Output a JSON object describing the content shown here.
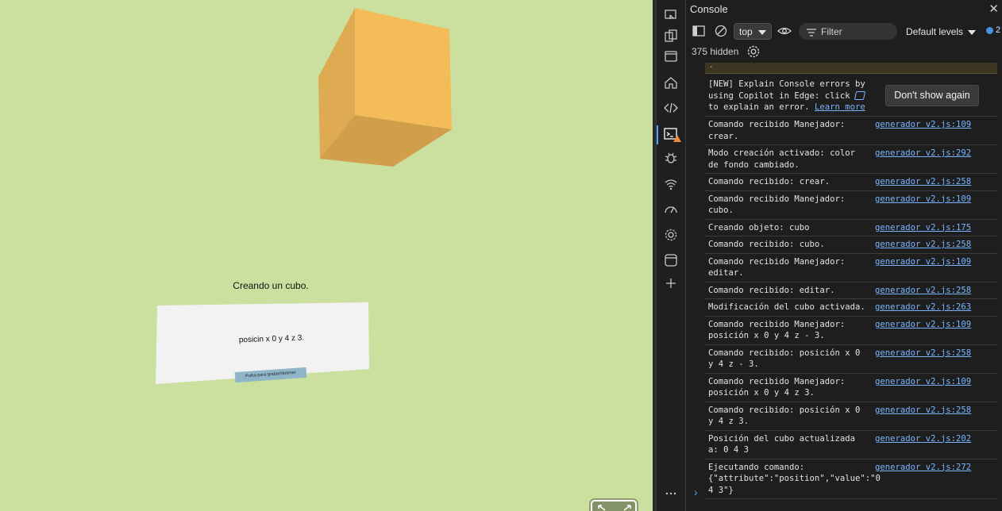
{
  "scene": {
    "background": "#cbe09f",
    "cube_colors": {
      "top": "#f3bc59",
      "left": "#deaa52",
      "bottom": "#d19e4c"
    },
    "caption": "Creando un cubo.",
    "panel_text": "posicin x 0 y 4 z 3.",
    "record_button": "Pulsa para grabar/detener",
    "vr_button_icon": "enter-vr-icon"
  },
  "devtools": {
    "activity_icons": [
      "device-emulation-icon",
      "inspect-icon",
      "browser-icon",
      "welcome-home-icon",
      "elements-code-icon",
      "console-icon",
      "sources-bug-icon",
      "network-wifi-icon",
      "performance-icon",
      "settings-gear-icon",
      "application-icon",
      "add-tool-icon",
      "more-tools-icon"
    ],
    "title": "Console",
    "context": "top",
    "filter_placeholder": "Filter",
    "levels": "Default levels",
    "issues_count": "2",
    "hidden_text": "375 hidden",
    "warning_fragment": ".",
    "copilot": {
      "line1": "[NEW] Explain Console errors by",
      "line2": "using Copilot in Edge: click",
      "line3": "to explain an error.",
      "learn_more": "Learn more",
      "dismiss": "Don't show again"
    },
    "messages": [
      {
        "text": "Comando recibido Manejador:\ncrear.",
        "source": "generador v2.js:109"
      },
      {
        "text": "Modo creación activado: color\nde fondo cambiado.",
        "source": "generador v2.js:292"
      },
      {
        "text": "Comando recibido: crear.",
        "source": "generador v2.js:258"
      },
      {
        "text": "Comando recibido Manejador:\ncubo.",
        "source": "generador v2.js:109"
      },
      {
        "text": "Creando objeto: cubo",
        "source": "generador v2.js:175"
      },
      {
        "text": "Comando recibido: cubo.",
        "source": "generador v2.js:258"
      },
      {
        "text": "Comando recibido Manejador:\neditar.",
        "source": "generador v2.js:109"
      },
      {
        "text": "Comando recibido: editar.",
        "source": "generador v2.js:258"
      },
      {
        "text": "Modificación del cubo activada.",
        "source": "generador v2.js:263"
      },
      {
        "text": "Comando recibido Manejador:\nposición x 0 y 4 z - 3.",
        "source": "generador v2.js:109"
      },
      {
        "text": "Comando recibido: posición x 0\ny 4 z - 3.",
        "source": "generador v2.js:258"
      },
      {
        "text": "Comando recibido Manejador:\nposición x 0 y 4 z 3.",
        "source": "generador v2.js:109"
      },
      {
        "text": "Comando recibido: posición x 0\ny 4 z 3.",
        "source": "generador v2.js:258"
      },
      {
        "text": "Posición del cubo actualizada\na: 0 4 3",
        "source": "generador v2.js:202"
      },
      {
        "text": "Ejecutando comando:\n{\"attribute\":\"position\",\"value\":\"0 4 3\"}",
        "source": "generador v2.js:272"
      }
    ],
    "prompt_symbol": "›"
  }
}
